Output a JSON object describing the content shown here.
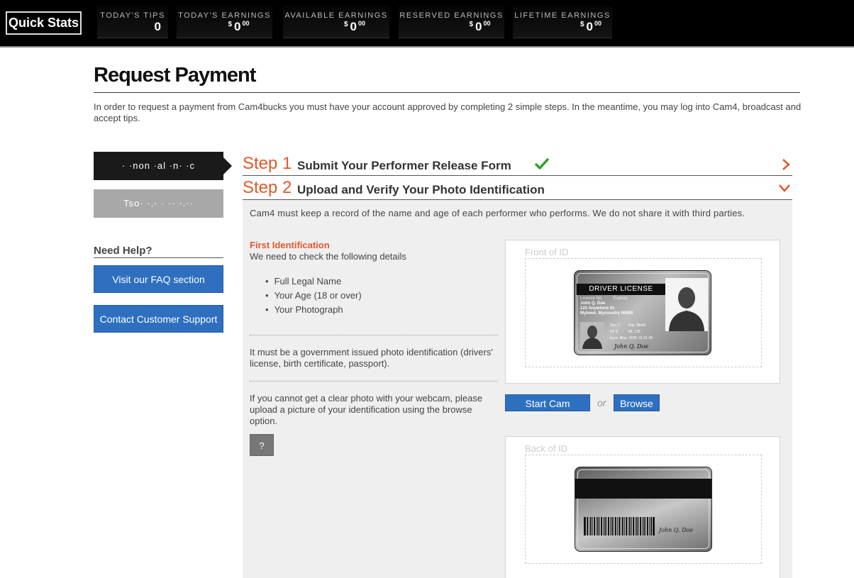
{
  "topbar": {
    "quick_stats_label": "Quick Stats",
    "stats": [
      {
        "label": "TODAY'S TIPS",
        "value": "0"
      },
      {
        "label": "TODAY'S EARNINGS",
        "currency": "$",
        "dollars": "0",
        "cents": "00"
      },
      {
        "label": "AVAILABLE EARNINGS",
        "currency": "$",
        "dollars": "0",
        "cents": "00"
      },
      {
        "label": "RESERVED EARNINGS",
        "currency": "$",
        "dollars": "0",
        "cents": "00"
      },
      {
        "label": "LIFETIME EARNINGS",
        "currency": "$",
        "dollars": "0",
        "cents": "00"
      }
    ]
  },
  "page": {
    "title": "Request Payment",
    "intro": "In order to request a payment from Cam4bucks you must have your account approved by completing 2 simple steps. In the meantime, you may log into Cam4, broadcast and accept tips."
  },
  "sidebar": {
    "steps": [
      {
        "label": "·   ·non    ·al ·n·  ·c",
        "active": true
      },
      {
        "label": "Tso·  ·.· · ··  ·.··",
        "active": false
      }
    ],
    "need_help": "Need Help?",
    "faq_button": "Visit our FAQ section",
    "support_button": "Contact Customer Support"
  },
  "steps": [
    {
      "number": "Step 1",
      "title": "Submit Your Performer Release Form",
      "completed": true,
      "icon": "chevron-right-icon"
    },
    {
      "number": "Step 2",
      "title": "Upload and Verify Your Photo Identification",
      "completed": false,
      "icon": "chevron-down-icon"
    }
  ],
  "panel": {
    "intro": "Cam4 must keep a record of the name and age of each performer who performs. We do not share it with third parties.",
    "first_id_heading": "First Identification",
    "check_details": "We need to check the following details",
    "details": [
      "Full Legal Name",
      "Your Age (18 or over)",
      "Your Photograph"
    ],
    "gov_text": "It must be a government issued photo identification (drivers' license, birth certificate, passport).",
    "webcam_text": "If you cannot get a clear photo with your webcam, please upload a picture of your identification using the browse option.",
    "help_button": "?",
    "front_label": "Front of ID",
    "back_label": "Back of ID",
    "start_cam": "Start Cam",
    "or": "or",
    "browse": "Browse"
  },
  "sample_card": {
    "heading": "DRIVER LICENSE",
    "license_no": "License No.",
    "expires": "Expires",
    "name": "John Q. Doe",
    "address1": "123 Anywhere St.",
    "address2": "Mytown, Mycountry 00000",
    "sex": "Sex: F",
    "hair": "Hair: Blond",
    "height": "Ht: 5'",
    "weight": "Wt: 125",
    "eyes": "Eyes: Blue",
    "dob": "DOB: 01-01-90",
    "signature": "John Q. Doe"
  },
  "colors": {
    "accent_orange": "#e4582a",
    "button_blue": "#2e6fc0",
    "check_green": "#2aa52a"
  }
}
